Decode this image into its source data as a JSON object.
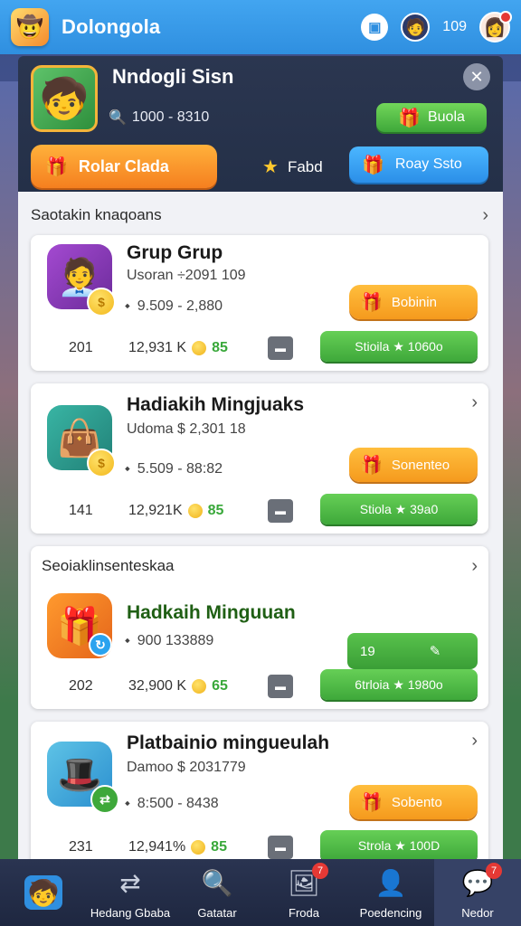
{
  "app": {
    "title": "Dolongola",
    "count": "109",
    "logo_icon": "character-logo-icon"
  },
  "profile": {
    "name": "Nndogli Sisn",
    "id_text": "1000 - 8310",
    "bonus_button": "Buola",
    "main_button": "Rolar Clada",
    "star_label": "Fabd",
    "blue_button": "Roay Ssto"
  },
  "sections": [
    {
      "header": "Saotakin knaqoans",
      "card": {
        "title": "Grup Grup",
        "subtitle": "Usoran ÷2091 109",
        "range": "9.509 - 2,880",
        "left_num": "201",
        "mid_value": "12,931 K",
        "mid_coin": "85",
        "orange_button": "Bobinin",
        "green_button": "Stioila ★ 1060o"
      }
    },
    {
      "header": "",
      "card": {
        "title": "Hadiakih Mingjuaks",
        "subtitle": "Udoma $ 2,301 18",
        "range": "5.509 - 88:82",
        "left_num": "141",
        "mid_value": "12,921K",
        "mid_coin": "85",
        "orange_button": "Sonenteo",
        "green_button": "Stiola ★ 39a0"
      }
    },
    {
      "header": "Seoiaklinsenteskaa",
      "card": {
        "title": "Hadkaih Minguuan",
        "subtitle": "",
        "range": "900 133889",
        "left_num": "202",
        "mid_value": "32,900 K",
        "mid_coin": "65",
        "green_top_button": "19",
        "green_button": "6trloia ★ 1980o"
      }
    },
    {
      "header": "",
      "card": {
        "title": "Platbainio mingueulah",
        "subtitle": "Damoo $ 2031779",
        "range": "8:500 - 8438",
        "left_num": "231",
        "mid_value": "12,941%",
        "mid_coin": "85",
        "orange_button": "Sobento",
        "green_button": "Strola ★ 100D"
      }
    }
  ],
  "nav": [
    {
      "label": "",
      "icon": "avatar-icon",
      "badge": ""
    },
    {
      "label": "Hedang Gbaba",
      "icon": "arrows-icon",
      "badge": ""
    },
    {
      "label": "Gatatar",
      "icon": "magnifier-icon",
      "badge": ""
    },
    {
      "label": "Froda",
      "icon": "photo-icon",
      "badge": "7"
    },
    {
      "label": "Poedencing",
      "icon": "user-search-icon",
      "badge": ""
    },
    {
      "label": "Nedor",
      "icon": "chat-icon",
      "badge": "7"
    }
  ],
  "colors": {
    "appbar": "#2f8fe0",
    "panel": "#2b3650",
    "accent_orange": "#f59a1d",
    "accent_green": "#3ea83a",
    "accent_blue": "#2b8fe8"
  }
}
